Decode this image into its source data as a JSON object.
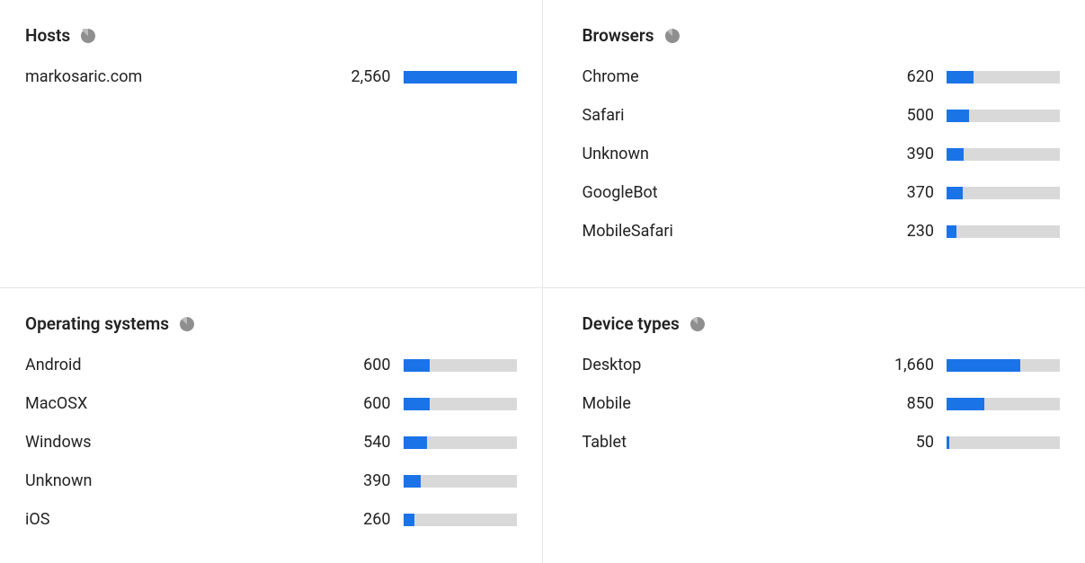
{
  "panels": {
    "hosts": {
      "title": "Hosts",
      "rows": [
        {
          "label": "markosaric.com",
          "value": 2560,
          "display": "2,560",
          "pct": 100
        }
      ]
    },
    "browsers": {
      "title": "Browsers",
      "rows": [
        {
          "label": "Chrome",
          "value": 620,
          "display": "620",
          "pct": 24.2
        },
        {
          "label": "Safari",
          "value": 500,
          "display": "500",
          "pct": 19.5
        },
        {
          "label": "Unknown",
          "value": 390,
          "display": "390",
          "pct": 15.2
        },
        {
          "label": "GoogleBot",
          "value": 370,
          "display": "370",
          "pct": 14.5
        },
        {
          "label": "MobileSafari",
          "value": 230,
          "display": "230",
          "pct": 9.0
        }
      ]
    },
    "os": {
      "title": "Operating systems",
      "rows": [
        {
          "label": "Android",
          "value": 600,
          "display": "600",
          "pct": 23.4
        },
        {
          "label": "MacOSX",
          "value": 600,
          "display": "600",
          "pct": 23.4
        },
        {
          "label": "Windows",
          "value": 540,
          "display": "540",
          "pct": 21.1
        },
        {
          "label": "Unknown",
          "value": 390,
          "display": "390",
          "pct": 15.2
        },
        {
          "label": "iOS",
          "value": 260,
          "display": "260",
          "pct": 10.2
        }
      ]
    },
    "devices": {
      "title": "Device types",
      "rows": [
        {
          "label": "Desktop",
          "value": 1660,
          "display": "1,660",
          "pct": 64.8
        },
        {
          "label": "Mobile",
          "value": 850,
          "display": "850",
          "pct": 33.2
        },
        {
          "label": "Tablet",
          "value": 50,
          "display": "50",
          "pct": 2.0
        }
      ]
    }
  },
  "colors": {
    "bar_fill": "#1b73e8",
    "bar_track": "#d9d9d9",
    "icon": "#8f8f8f"
  },
  "chart_data": [
    {
      "type": "bar",
      "title": "Hosts",
      "categories": [
        "markosaric.com"
      ],
      "values": [
        2560
      ],
      "xlabel": "",
      "ylabel": "",
      "ylim": [
        0,
        2560
      ]
    },
    {
      "type": "bar",
      "title": "Browsers",
      "categories": [
        "Chrome",
        "Safari",
        "Unknown",
        "GoogleBot",
        "MobileSafari"
      ],
      "values": [
        620,
        500,
        390,
        370,
        230
      ],
      "xlabel": "",
      "ylabel": "",
      "ylim": [
        0,
        2560
      ]
    },
    {
      "type": "bar",
      "title": "Operating systems",
      "categories": [
        "Android",
        "MacOSX",
        "Windows",
        "Unknown",
        "iOS"
      ],
      "values": [
        600,
        600,
        540,
        390,
        260
      ],
      "xlabel": "",
      "ylabel": "",
      "ylim": [
        0,
        2560
      ]
    },
    {
      "type": "bar",
      "title": "Device types",
      "categories": [
        "Desktop",
        "Mobile",
        "Tablet"
      ],
      "values": [
        1660,
        850,
        50
      ],
      "xlabel": "",
      "ylabel": "",
      "ylim": [
        0,
        2560
      ]
    }
  ]
}
